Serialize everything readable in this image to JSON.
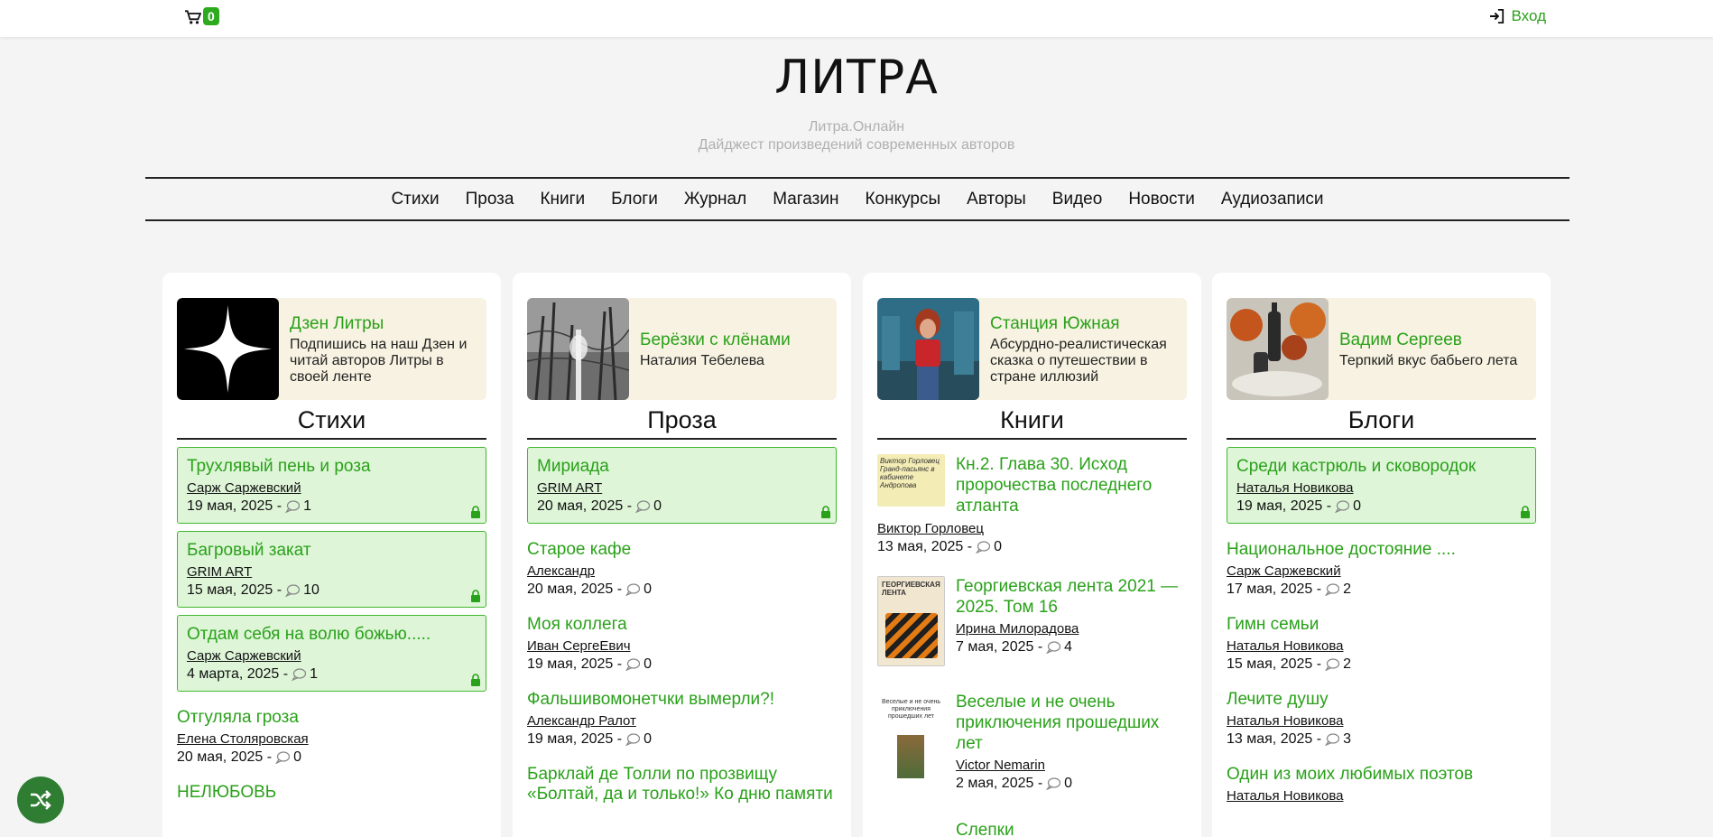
{
  "topbar": {
    "cart_count": "0",
    "login_label": "Вход"
  },
  "site": {
    "logo": "ЛИТРА",
    "tagline1": "Литра.Онлайн",
    "tagline2": "Дайджест произведений современных авторов"
  },
  "nav": [
    "Стихи",
    "Проза",
    "Книги",
    "Блоги",
    "Журнал",
    "Магазин",
    "Конкурсы",
    "Авторы",
    "Видео",
    "Новости",
    "Аудиозаписи"
  ],
  "columns": {
    "poems": {
      "feature": {
        "title": "Дзен Литры",
        "desc": "Подпишись на наш Дзен и читай авторов Литры в своей ленте"
      },
      "section": "Стихи",
      "items": [
        {
          "title": "Трухлявый пень и роза",
          "author": "Сарж Саржевский",
          "meta": "19 мая, 2025 -",
          "comments": "1"
        },
        {
          "title": "Багровый закат",
          "author": "GRIM ART",
          "meta": "15 мая, 2025 -",
          "comments": "10"
        },
        {
          "title": "Отдам себя на волю божью.....",
          "author": "Сарж Саржевский",
          "meta": "4 марта, 2025 -",
          "comments": "1"
        },
        {
          "title": "Отгуляла гроза",
          "author": "Елена Столяровская",
          "meta": "20 мая, 2025 -",
          "comments": "0"
        },
        {
          "title": "НЕЛЮБОВЬ"
        }
      ]
    },
    "prose": {
      "feature": {
        "title": "Берёзки с клёнами",
        "desc": "Наталия Тебелева"
      },
      "section": "Проза",
      "items": [
        {
          "title": "Мириада",
          "author": "GRIM ART",
          "meta": "20 мая, 2025 -",
          "comments": "0"
        },
        {
          "title": "Старое кафе",
          "author": "Александр",
          "meta": "20 мая, 2025 -",
          "comments": "0"
        },
        {
          "title": "Моя коллега",
          "author": "Иван СергеЕвич",
          "meta": "19 мая, 2025 -",
          "comments": "0"
        },
        {
          "title": "Фальшивомонетчки вымерли?!",
          "author": "Александр Ралот",
          "meta": "19 мая, 2025 -",
          "comments": "0"
        },
        {
          "title": "Барклай де Толли по прозвищу «Болтай, да и только!» Ко дню памяти"
        }
      ]
    },
    "books": {
      "feature": {
        "title": "Станция Южная",
        "desc": "Абсурдно-реалистическая сказка о путешествии в стране иллюзий"
      },
      "section": "Книги",
      "items": [
        {
          "title": "Кн.2. Глава 30. Исход пророчества последнего атланта",
          "author": "Виктор Горловец",
          "meta": "13 мая, 2025 -",
          "comments": "0",
          "cover_text": "Виктор Горловец Гранд-пасьянс в кабинете Андропова"
        },
        {
          "title": "Георгиевская лента 2021 — 2025. Том 16",
          "author": "Ирина Милорадова",
          "meta": "7 мая, 2025 -",
          "comments": "4",
          "cover_text": "ГЕОРГИЕВСКАЯ ЛЕНТА"
        },
        {
          "title": "Веселые и не очень приключения прошедших лет",
          "author": "Victor Nemarin",
          "meta": "2 мая, 2025 -",
          "comments": "0",
          "cover_text": "Веселые и не очень приключения прошедших лет"
        },
        {
          "title": "Слепки"
        }
      ]
    },
    "blogs": {
      "feature": {
        "title": "Вадим Сергеев",
        "desc": "Терпкий вкус бабьего лета"
      },
      "section": "Блоги",
      "items": [
        {
          "title": "Среди кастрюль и сковородок",
          "author": "Наталья Новикова",
          "meta": "19 мая, 2025 -",
          "comments": "0"
        },
        {
          "title": "Национальное достояние ....",
          "author": "Сарж Саржевский",
          "meta": "17 мая, 2025 -",
          "comments": "2"
        },
        {
          "title": "Гимн семьи",
          "author": "Наталья Новикова",
          "meta": "15 мая, 2025 -",
          "comments": "2"
        },
        {
          "title": "Лечите душу",
          "author": "Наталья Новикова",
          "meta": "13 мая, 2025 -",
          "comments": "3"
        },
        {
          "title": "Один из моих любимых поэтов",
          "author": "Наталья Новикова"
        }
      ]
    }
  },
  "colors": {
    "accent_green": "#2aa11a",
    "boxed_bg": "#def5d8",
    "feature_bg": "#f7f2e1",
    "shuffle_bg": "#2e7d32"
  },
  "icons": [
    "cart-icon",
    "login-icon",
    "comment-icon",
    "lock-icon",
    "shuffle-icon"
  ]
}
